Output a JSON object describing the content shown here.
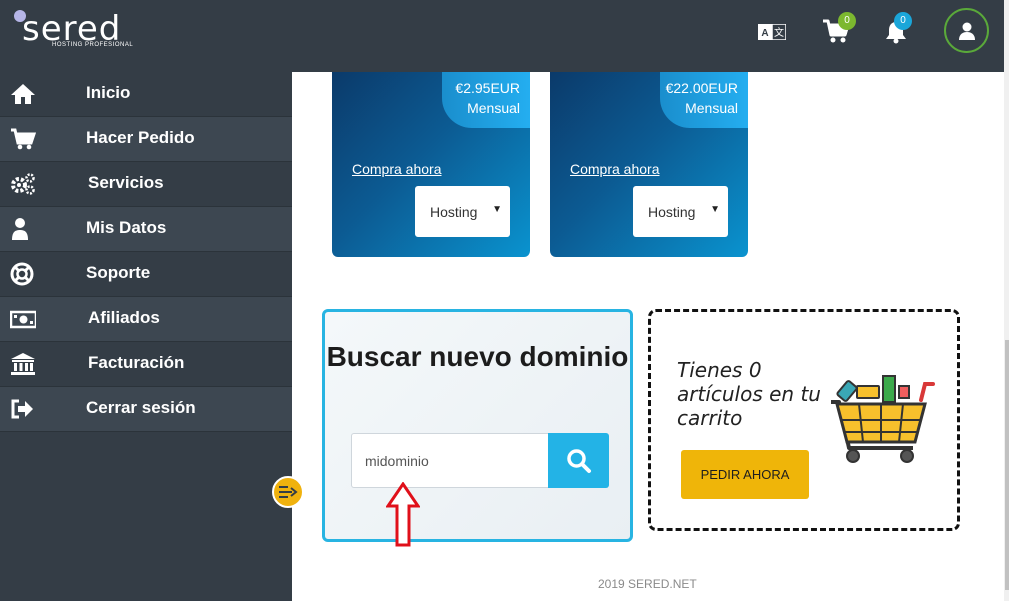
{
  "logo": {
    "text": "sered",
    "subtitle": "HOSTING PROFESIONAL"
  },
  "header": {
    "cart_count": "0",
    "notif_count": "0"
  },
  "sidebar": {
    "items": [
      {
        "label": "Inicio",
        "icon": "home-icon"
      },
      {
        "label": "Hacer Pedido",
        "icon": "cart-icon"
      },
      {
        "label": "Servicios",
        "icon": "gears-icon"
      },
      {
        "label": "Mis Datos",
        "icon": "user-icon"
      },
      {
        "label": "Soporte",
        "icon": "lifebuoy-icon"
      },
      {
        "label": "Afiliados",
        "icon": "money-icon"
      },
      {
        "label": "Facturación",
        "icon": "bank-icon"
      },
      {
        "label": "Cerrar sesión",
        "icon": "sign-out-icon"
      }
    ]
  },
  "cards": [
    {
      "price": "€2.95EUR",
      "period": "Mensual",
      "link": "Compra ahora",
      "select": "Hosting"
    },
    {
      "price": "€22.00EUR",
      "period": "Mensual",
      "link": "Compra ahora",
      "select": "Hosting"
    }
  ],
  "domain": {
    "title": "Buscar nuevo dominio",
    "input_value": "midominio"
  },
  "cart": {
    "message": "Tienes 0 artículos en tu carrito",
    "button": "PEDIR AHORA"
  },
  "footer": {
    "text": "2019 SERED.NET"
  },
  "colors": {
    "sidebar_bg": "#343d46",
    "accent_blue": "#23b3e6",
    "accent_yellow": "#efb509",
    "badge_green": "#7cb82f"
  }
}
